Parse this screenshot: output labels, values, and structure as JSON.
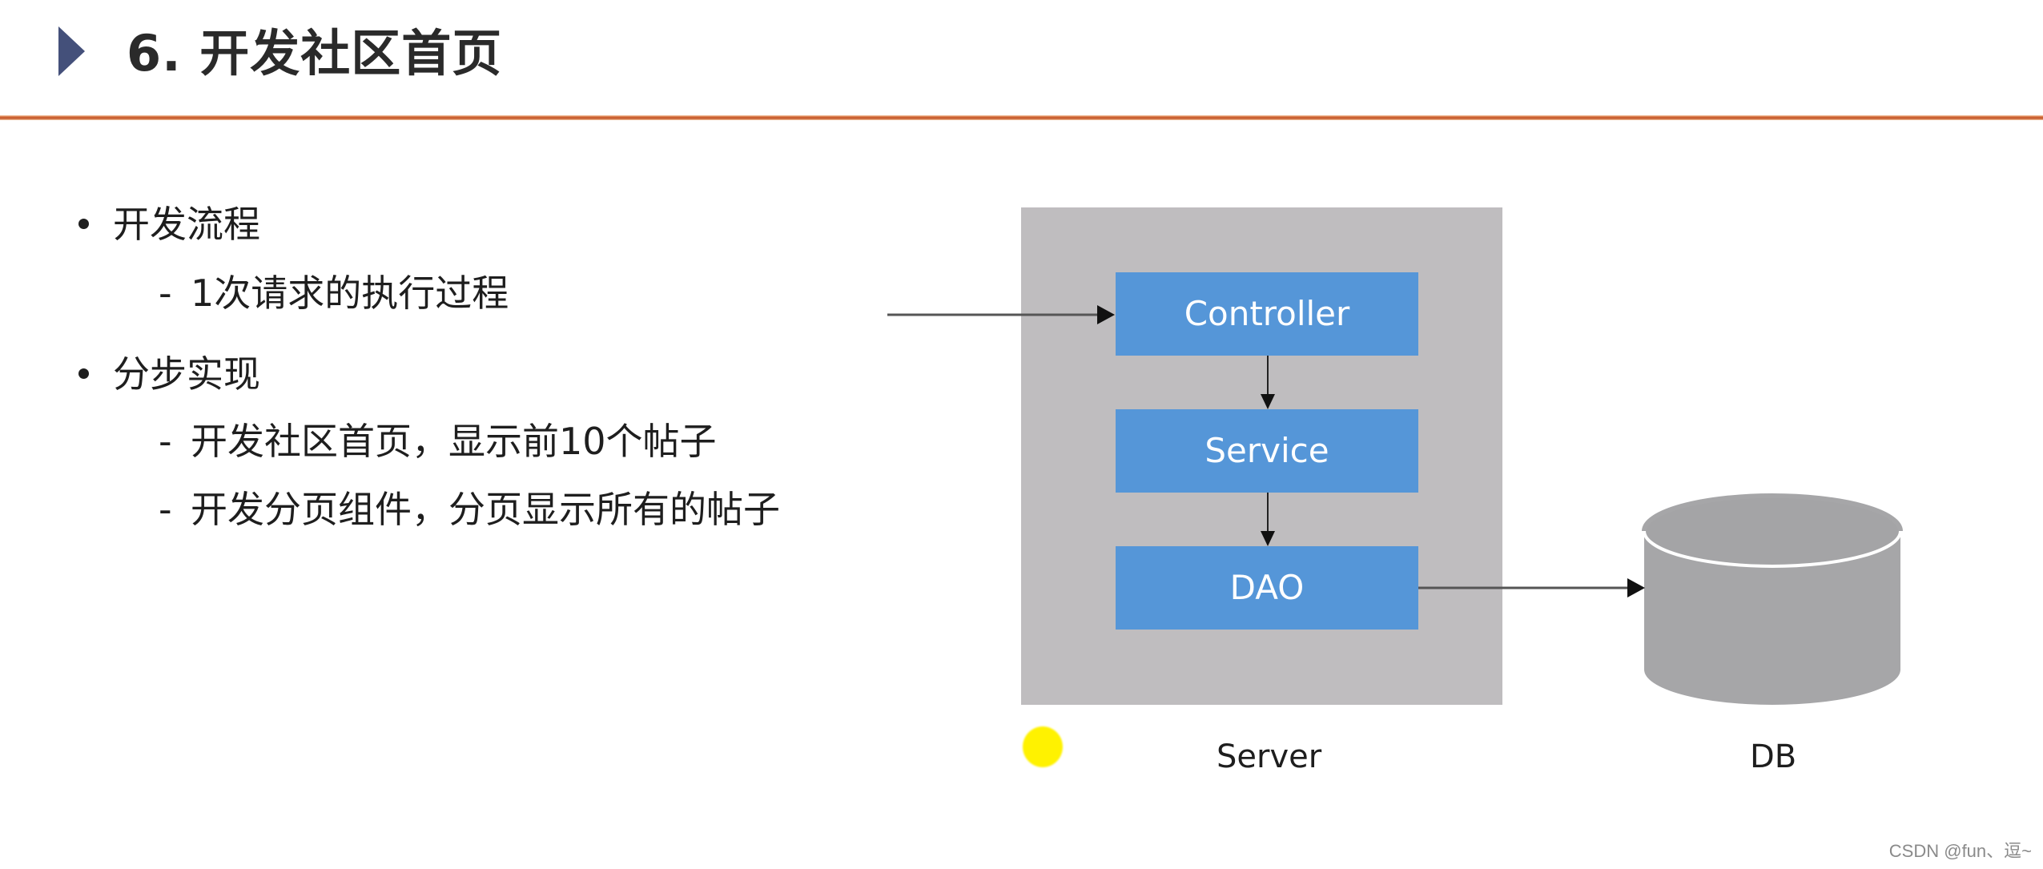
{
  "slide": {
    "title": "6. 开发社区首页",
    "watermark": "",
    "footer_credit": "CSDN @fun、逗~"
  },
  "bullets": [
    {
      "label": "开发流程",
      "sub": [
        "1次请求的执行过程"
      ]
    },
    {
      "label": "分步实现",
      "sub": [
        "开发社区首页，显示前10个帖子",
        "开发分页组件，分页显示所有的帖子"
      ]
    }
  ],
  "diagram": {
    "server_label": "Server",
    "db_label": "DB",
    "layers": [
      "Controller",
      "Service",
      "DAO"
    ],
    "colors": {
      "server_bg": "#bfbdbf",
      "layer_bg": "#5596d8",
      "layer_text": "#ffffff",
      "db_fill": "#a6a6a8",
      "accent_rule": "#cf6535",
      "title_marker": "#44507a",
      "cursor_highlight": "#fff200"
    }
  }
}
